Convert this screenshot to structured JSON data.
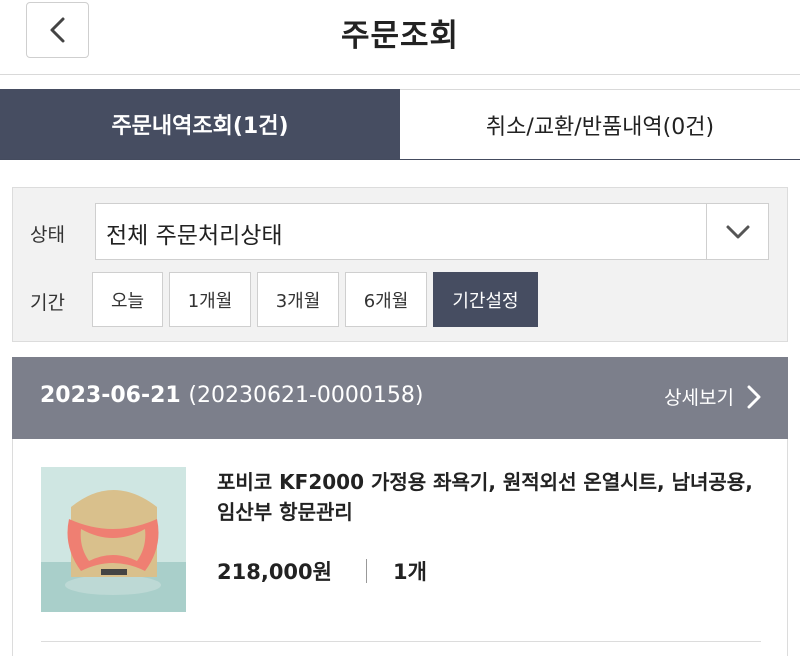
{
  "header": {
    "title": "주문조회",
    "back_icon": "chevron-left-icon"
  },
  "tabs": [
    {
      "label": "주문내역조회(1건)",
      "active": true
    },
    {
      "label": "취소/교환/반품내역(0건)",
      "active": false
    }
  ],
  "filter": {
    "status_label": "상태",
    "status_value": "전체 주문처리상태",
    "period_label": "기간",
    "period_buttons": [
      "오늘",
      "1개월",
      "3개월",
      "6개월",
      "기간설정"
    ],
    "active_period": "기간설정"
  },
  "order": {
    "date": "2023-06-21",
    "number": "(20230621-0000158)",
    "detail_label": "상세보기",
    "product_name": "포비코 KF2000 가정용 좌욕기, 원적외선 온열시트, 남녀공용, 임산부 항문관리",
    "price": "218,000원",
    "quantity": "1개"
  },
  "colors": {
    "accent_dark": "#464d61",
    "order_header": "#7c7f8b"
  }
}
